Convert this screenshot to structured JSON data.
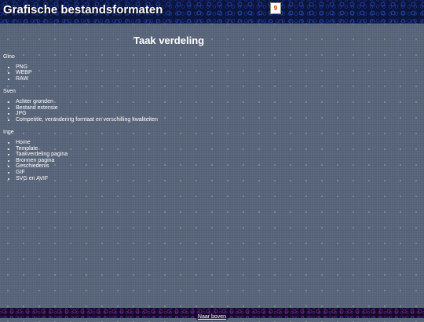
{
  "header": {
    "site_title": "Grafische bestandsformaten",
    "logo_icon": "logo-icon",
    "logo_glyph": "9"
  },
  "main": {
    "page_title": "Taak verdeling",
    "people": [
      {
        "name": "Gino",
        "tasks": [
          "PNG",
          "WEBP",
          "RAW"
        ]
      },
      {
        "name": "Sven",
        "tasks": [
          "Achter gronden",
          "Bestand extensie",
          "JPG",
          "Competitie, verandering formaat en verschilling kwaliteiten"
        ]
      },
      {
        "name": "Inge",
        "tasks": [
          "Home",
          "Template",
          "Taakverdeling pagina",
          "Bronnen pagina",
          "Geschiedenis",
          "GIF",
          "SVG en AVIF"
        ]
      }
    ]
  },
  "footer": {
    "back_to_top_label": "Naar boven"
  },
  "colors": {
    "page_background": "#59657a",
    "header_background": "#0b1540",
    "footer_background": "#140a2a",
    "text": "#ffffff"
  }
}
